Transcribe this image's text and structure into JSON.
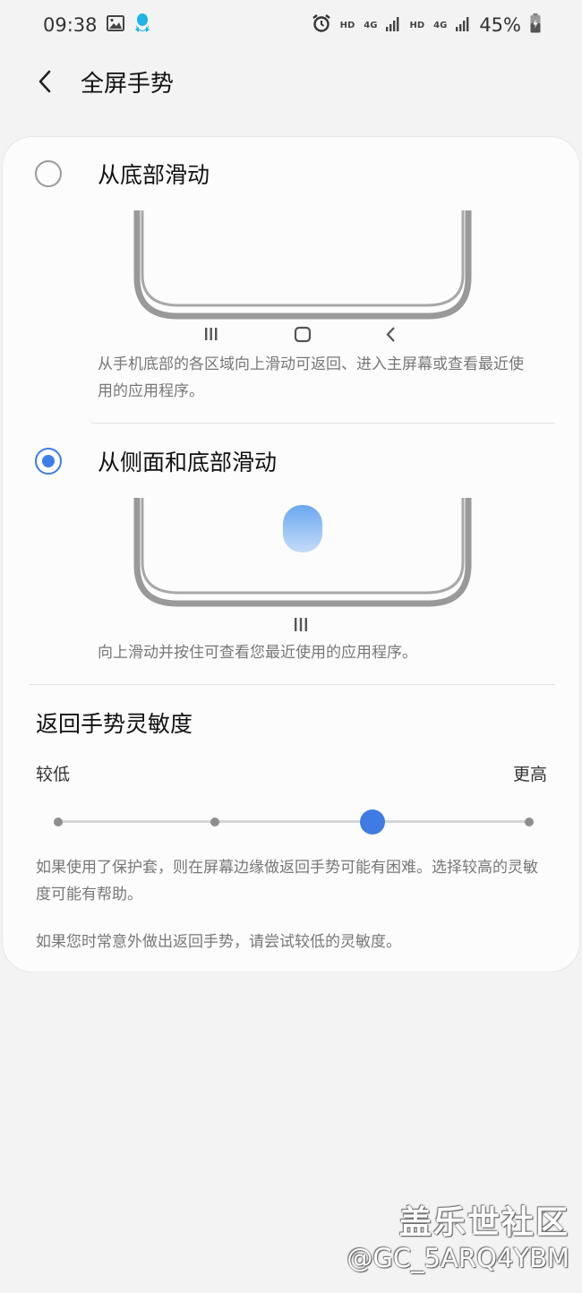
{
  "status_bar": {
    "time": "09:38",
    "hd1": "HD",
    "net1": "4G",
    "hd2": "HD",
    "net2": "4G",
    "battery": "45%",
    "icons": [
      "image-icon",
      "qq-icon",
      "alarm-icon",
      "signal-icon",
      "battery-charging-icon"
    ]
  },
  "header": {
    "title": "全屏手势",
    "back_icon": "chevron-left-icon"
  },
  "options": [
    {
      "label": "从底部滑动",
      "selected": false,
      "description": "从手机底部的各区域向上滑动可返回、进入主屏幕或查看最近使用的应用程序。",
      "nav_icons": [
        "recents-icon",
        "home-icon",
        "back-icon"
      ]
    },
    {
      "label": "从侧面和底部滑动",
      "selected": true,
      "description": "向上滑动并按住可查看您最近使用的应用程序。",
      "nav_icons": [
        "recents-icon"
      ]
    }
  ],
  "sensitivity": {
    "title": "返回手势灵敏度",
    "min_label": "较低",
    "max_label": "更高",
    "steps": 4,
    "value": 3,
    "notes": [
      "如果使用了保护套，则在屏幕边缘做返回手势可能有困难。选择较高的灵敏度可能有帮助。",
      "如果您时常意外做出返回手势，请尝试较低的灵敏度。"
    ]
  },
  "colors": {
    "accent": "#3d7de8",
    "background": "#f3f3f3",
    "card": "#fcfcfc",
    "secondary_text": "#777777"
  },
  "watermark": {
    "line1": "盖乐世社区",
    "line2": "@GC_5ARQ4YBM"
  }
}
